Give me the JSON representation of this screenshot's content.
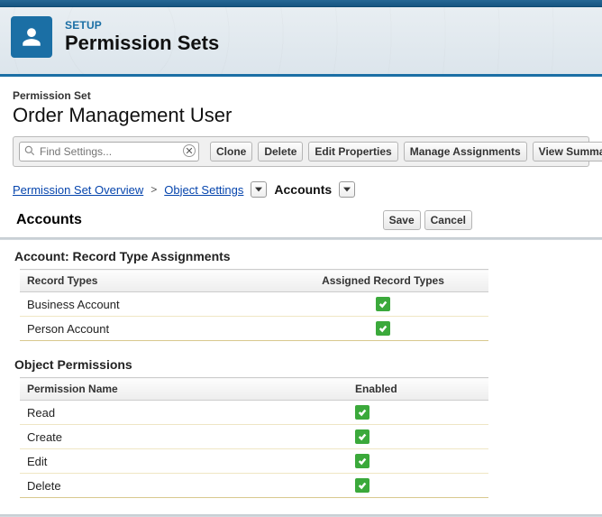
{
  "header": {
    "eyebrow": "SETUP",
    "title": "Permission Sets"
  },
  "page": {
    "entity_label": "Permission Set",
    "name": "Order Management User"
  },
  "search": {
    "placeholder": "Find Settings..."
  },
  "toolbar": {
    "clone": "Clone",
    "delete": "Delete",
    "edit_properties": "Edit Properties",
    "manage_assignments": "Manage Assignments",
    "view_summary": "View Summary (Beta)"
  },
  "breadcrumb": {
    "overview": "Permission Set Overview",
    "object_settings": "Object Settings",
    "current": "Accounts"
  },
  "section": {
    "title": "Accounts",
    "save": "Save",
    "cancel": "Cancel"
  },
  "record_types": {
    "heading": "Account: Record Type Assignments",
    "col_name": "Record Types",
    "col_assigned": "Assigned Record Types",
    "rows": [
      {
        "name": "Business Account",
        "assigned": true
      },
      {
        "name": "Person Account",
        "assigned": true
      }
    ]
  },
  "object_permissions": {
    "heading": "Object Permissions",
    "col_name": "Permission Name",
    "col_enabled": "Enabled",
    "rows": [
      {
        "name": "Read",
        "enabled": true
      },
      {
        "name": "Create",
        "enabled": true
      },
      {
        "name": "Edit",
        "enabled": true
      },
      {
        "name": "Delete",
        "enabled": true
      }
    ]
  }
}
